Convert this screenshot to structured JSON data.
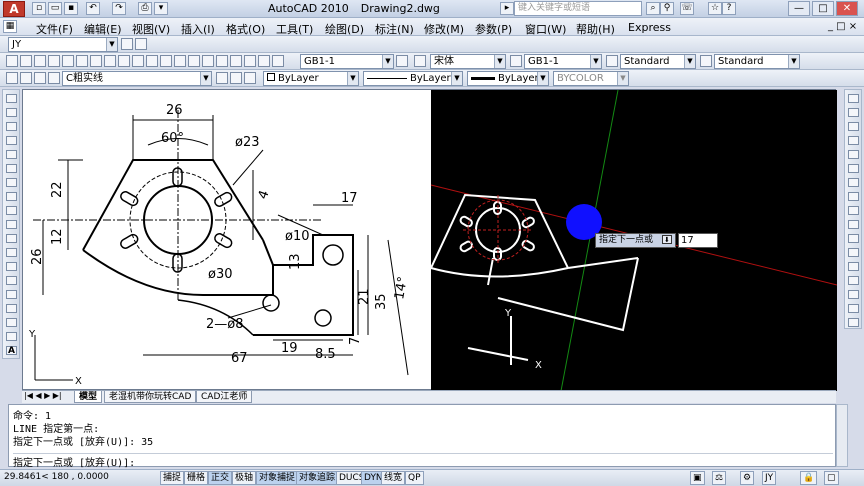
{
  "window": {
    "title": "AutoCAD 2010",
    "document": "Drawing2.dwg",
    "search_placeholder": "键入关键字或短语",
    "app_button": "A",
    "controls": [
      "—",
      "□",
      "✕"
    ]
  },
  "menu": [
    "文件(F)",
    "编辑(E)",
    "视图(V)",
    "插入(I)",
    "格式(O)",
    "工具(T)",
    "绘图(D)",
    "标注(N)",
    "修改(M)",
    "参数(P)",
    "窗口(W)",
    "帮助(H)",
    "Express"
  ],
  "workspace_combo": "JY",
  "toolbar": {
    "dimstyle": "GB1-1",
    "textstyle": "宋体",
    "dimstyle2": "GB1-1",
    "tablestyle": "Standard",
    "mleaderstyle": "Standard",
    "layer": "C粗实线",
    "color": "ByLayer",
    "linetype": "ByLayer",
    "lineweight": "ByLayer",
    "plotstyle": "BYCOLOR"
  },
  "drawing": {
    "dims": {
      "d26": "26",
      "d60": "60°",
      "d23": "ø23",
      "d4": "4",
      "d22": "22",
      "d12": "12",
      "d26v": "26",
      "d17": "17",
      "d10": "ø10",
      "d13": "13",
      "d30": "ø30",
      "d28": "2—ø8",
      "d21": "21",
      "d35": "35",
      "d14": "14°",
      "d7": "7",
      "d67": "67",
      "d19": "19",
      "d85": "8.5"
    },
    "ucs_x": "X",
    "ucs_y": "Y",
    "dyn_prompt": "指定下一点或",
    "dyn_value": "17"
  },
  "tabs": [
    "模型",
    "老湿机带你玩转CAD",
    "CAD江老师"
  ],
  "command": {
    "lines": [
      "命令: 1",
      "LINE 指定第一点:",
      "指定下一点或 [放弃(U)]: 35"
    ],
    "prompt": "指定下一点或 [放弃(U)]:"
  },
  "status": {
    "coords": "29.8461< 180    , 0.0000",
    "buttons": [
      {
        "label": "捕捉",
        "on": false
      },
      {
        "label": "栅格",
        "on": false
      },
      {
        "label": "正交",
        "on": true
      },
      {
        "label": "极轴",
        "on": false
      },
      {
        "label": "对象捕捉",
        "on": true
      },
      {
        "label": "对象追踪",
        "on": true
      },
      {
        "label": "DUCS",
        "on": false
      },
      {
        "label": "DYN",
        "on": true
      },
      {
        "label": "线宽",
        "on": false
      },
      {
        "label": "QP",
        "on": false
      }
    ],
    "workspace": "JY"
  },
  "colors": {
    "accent": "#3a6fc2",
    "drawing_bg_dark": "#000000",
    "crosshair_red": "#b01010",
    "crosshair_green": "#138a13",
    "dyn_blue": "#1010ff"
  }
}
